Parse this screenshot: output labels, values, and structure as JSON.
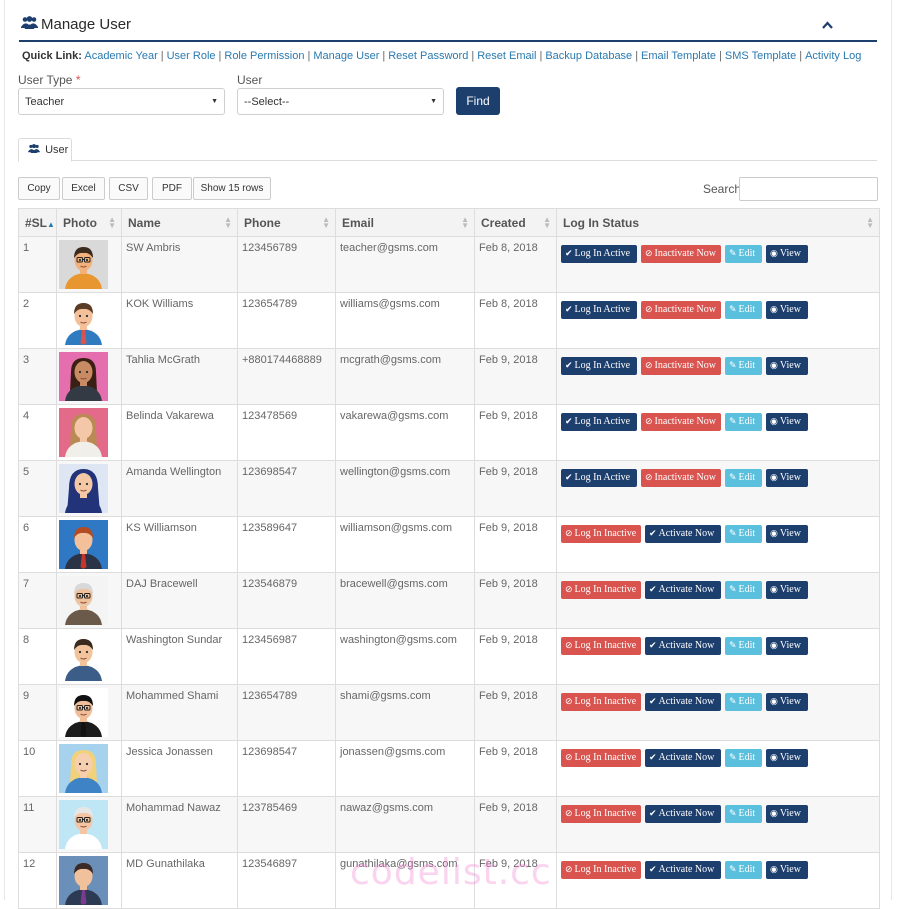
{
  "header": {
    "title": "Manage User",
    "icon": "users-icon",
    "collapse_icon": "chevron-up-icon"
  },
  "quick_links": {
    "label": "Quick Link:",
    "items": [
      "Academic Year",
      "User Role",
      "Role Permission",
      "Manage User",
      "Reset Password",
      "Reset Email",
      "Backup Database",
      "Email Template",
      "SMS Template",
      "Activity Log"
    ]
  },
  "filters": {
    "user_type_label": "User Type",
    "required_mark": "*",
    "user_type_value": "Teacher",
    "user_label": "User",
    "user_value": "--Select--",
    "find_label": "Find"
  },
  "tab": {
    "label": "User",
    "icon": "users-icon"
  },
  "export": {
    "copy": "Copy",
    "excel": "Excel",
    "csv": "CSV",
    "pdf": "PDF",
    "rows": "Show 15 rows"
  },
  "search": {
    "label": "Search:",
    "value": ""
  },
  "table": {
    "columns": [
      "#SL",
      "Photo",
      "Name",
      "Phone",
      "Email",
      "Created",
      "Log In Status"
    ],
    "sorted_column": "#SL",
    "rows": [
      {
        "sl": "1",
        "avatar": "man-glasses",
        "name": "SW Ambris",
        "phone": "123456789",
        "email": "teacher@gsms.com",
        "created": "Feb 8, 2018",
        "active": true
      },
      {
        "sl": "2",
        "avatar": "man-red-tie",
        "name": "KOK Williams",
        "phone": "123654789",
        "email": "williams@gsms.com",
        "created": "Feb 8, 2018",
        "active": true
      },
      {
        "sl": "3",
        "avatar": "woman-dark-hair",
        "name": "Tahlia McGrath",
        "phone": "+880174468889",
        "email": "mcgrath@gsms.com",
        "created": "Feb 9, 2018",
        "active": true
      },
      {
        "sl": "4",
        "avatar": "woman-faceless",
        "name": "Belinda Vakarewa",
        "phone": "123478569",
        "email": "vakarewa@gsms.com",
        "created": "Feb 9, 2018",
        "active": true
      },
      {
        "sl": "5",
        "avatar": "woman-hijab",
        "name": "Amanda Wellington",
        "phone": "123698547",
        "email": "wellington@gsms.com",
        "created": "Feb 9, 2018",
        "active": true
      },
      {
        "sl": "6",
        "avatar": "man-faceless",
        "name": "KS Williamson",
        "phone": "123589647",
        "email": "williamson@gsms.com",
        "created": "Feb 9, 2018",
        "active": false
      },
      {
        "sl": "7",
        "avatar": "old-man",
        "name": "DAJ Bracewell",
        "phone": "123546879",
        "email": "bracewell@gsms.com",
        "created": "Feb 9, 2018",
        "active": false
      },
      {
        "sl": "8",
        "avatar": "man-smiling",
        "name": "Washington Sundar",
        "phone": "123456987",
        "email": "washington@gsms.com",
        "created": "Feb 9, 2018",
        "active": false
      },
      {
        "sl": "9",
        "avatar": "man-glasses-tie",
        "name": "Mohammed Shami",
        "phone": "123654789",
        "email": "shami@gsms.com",
        "created": "Feb 9, 2018",
        "active": false
      },
      {
        "sl": "10",
        "avatar": "woman-blonde",
        "name": "Jessica Jonassen",
        "phone": "123698547",
        "email": "jonassen@gsms.com",
        "created": "Feb 9, 2018",
        "active": false
      },
      {
        "sl": "11",
        "avatar": "doctor",
        "name": "Mohammad Nawaz",
        "phone": "123785469",
        "email": "nawaz@gsms.com",
        "created": "Feb 9, 2018",
        "active": false
      },
      {
        "sl": "12",
        "avatar": "man-faceless-purple",
        "name": "MD Gunathilaka",
        "phone": "123546897",
        "email": "gunathilaka@gsms.com",
        "created": "Feb 9, 2018",
        "active": false
      }
    ]
  },
  "actions": {
    "log_in_active": "Log In Active",
    "inactivate_now": "Inactivate Now",
    "log_in_inactive": "Log In Inactive",
    "activate_now": "Activate Now",
    "edit": "Edit",
    "view": "View"
  },
  "watermark": "codelist.cc",
  "colors": {
    "primary": "#1c3f6e",
    "danger": "#d9534f",
    "info": "#5bc0de",
    "link": "#2a7ab0"
  }
}
